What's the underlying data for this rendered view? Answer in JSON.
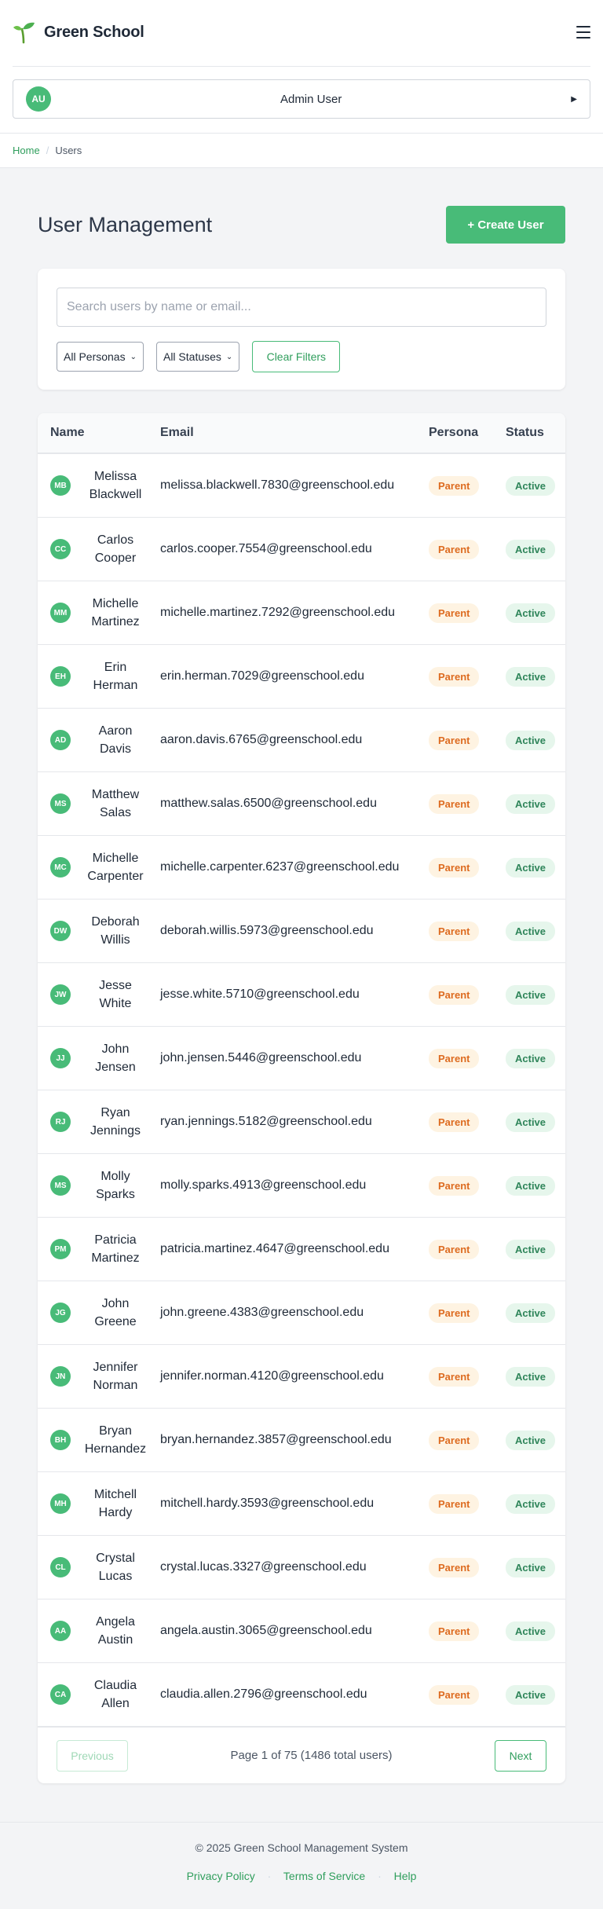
{
  "header": {
    "brand_name": "Green School",
    "user": {
      "initials": "AU",
      "name": "Admin User"
    }
  },
  "breadcrumb": {
    "home": "Home",
    "current": "Users"
  },
  "page": {
    "title": "User Management",
    "create_label": "+ Create User"
  },
  "filters": {
    "search_placeholder": "Search users by name or email...",
    "persona_selected": "All Personas",
    "status_selected": "All Statuses",
    "clear_label": "Clear Filters"
  },
  "table": {
    "headers": {
      "name": "Name",
      "email": "Email",
      "persona": "Persona",
      "status": "Status"
    },
    "rows": [
      {
        "initials": "MB",
        "first": "Melissa",
        "last": "Blackwell",
        "email": "melissa.blackwell.7830@greenschool.edu",
        "persona": "Parent",
        "status": "Active"
      },
      {
        "initials": "CC",
        "first": "Carlos",
        "last": "Cooper",
        "email": "carlos.cooper.7554@greenschool.edu",
        "persona": "Parent",
        "status": "Active"
      },
      {
        "initials": "MM",
        "first": "Michelle",
        "last": "Martinez",
        "email": "michelle.martinez.7292@greenschool.edu",
        "persona": "Parent",
        "status": "Active"
      },
      {
        "initials": "EH",
        "first": "Erin",
        "last": "Herman",
        "email": "erin.herman.7029@greenschool.edu",
        "persona": "Parent",
        "status": "Active"
      },
      {
        "initials": "AD",
        "first": "Aaron",
        "last": "Davis",
        "email": "aaron.davis.6765@greenschool.edu",
        "persona": "Parent",
        "status": "Active"
      },
      {
        "initials": "MS",
        "first": "Matthew",
        "last": "Salas",
        "email": "matthew.salas.6500@greenschool.edu",
        "persona": "Parent",
        "status": "Active"
      },
      {
        "initials": "MC",
        "first": "Michelle",
        "last": "Carpenter",
        "email": "michelle.carpenter.6237@greenschool.edu",
        "persona": "Parent",
        "status": "Active"
      },
      {
        "initials": "DW",
        "first": "Deborah",
        "last": "Willis",
        "email": "deborah.willis.5973@greenschool.edu",
        "persona": "Parent",
        "status": "Active"
      },
      {
        "initials": "JW",
        "first": "Jesse",
        "last": "White",
        "email": "jesse.white.5710@greenschool.edu",
        "persona": "Parent",
        "status": "Active"
      },
      {
        "initials": "JJ",
        "first": "John",
        "last": "Jensen",
        "email": "john.jensen.5446@greenschool.edu",
        "persona": "Parent",
        "status": "Active"
      },
      {
        "initials": "RJ",
        "first": "Ryan",
        "last": "Jennings",
        "email": "ryan.jennings.5182@greenschool.edu",
        "persona": "Parent",
        "status": "Active"
      },
      {
        "initials": "MS",
        "first": "Molly",
        "last": "Sparks",
        "email": "molly.sparks.4913@greenschool.edu",
        "persona": "Parent",
        "status": "Active"
      },
      {
        "initials": "PM",
        "first": "Patricia",
        "last": "Martinez",
        "email": "patricia.martinez.4647@greenschool.edu",
        "persona": "Parent",
        "status": "Active"
      },
      {
        "initials": "JG",
        "first": "John",
        "last": "Greene",
        "email": "john.greene.4383@greenschool.edu",
        "persona": "Parent",
        "status": "Active"
      },
      {
        "initials": "JN",
        "first": "Jennifer",
        "last": "Norman",
        "email": "jennifer.norman.4120@greenschool.edu",
        "persona": "Parent",
        "status": "Active"
      },
      {
        "initials": "BH",
        "first": "Bryan",
        "last": "Hernandez",
        "email": "bryan.hernandez.3857@greenschool.edu",
        "persona": "Parent",
        "status": "Active"
      },
      {
        "initials": "MH",
        "first": "Mitchell",
        "last": "Hardy",
        "email": "mitchell.hardy.3593@greenschool.edu",
        "persona": "Parent",
        "status": "Active"
      },
      {
        "initials": "CL",
        "first": "Crystal",
        "last": "Lucas",
        "email": "crystal.lucas.3327@greenschool.edu",
        "persona": "Parent",
        "status": "Active"
      },
      {
        "initials": "AA",
        "first": "Angela",
        "last": "Austin",
        "email": "angela.austin.3065@greenschool.edu",
        "persona": "Parent",
        "status": "Active"
      },
      {
        "initials": "CA",
        "first": "Claudia",
        "last": "Allen",
        "email": "claudia.allen.2796@greenschool.edu",
        "persona": "Parent",
        "status": "Active"
      }
    ]
  },
  "pagination": {
    "prev_label": "Previous",
    "info": "Page 1 of 75 (1486 total users)",
    "next_label": "Next"
  },
  "footer": {
    "copyright": "© 2025 Green School Management System",
    "links": [
      "Privacy Policy",
      "Terms of Service",
      "Help"
    ]
  },
  "colors": {
    "brand_green": "#48bb78",
    "persona_badge": "#dd6b20",
    "status_badge": "#2f855a"
  },
  "icons": {
    "brand": "sprout-icon",
    "menu": "hamburger-menu-icon",
    "user_caret": "caret-right-icon",
    "select_arrow": "chevron-down-icon"
  }
}
